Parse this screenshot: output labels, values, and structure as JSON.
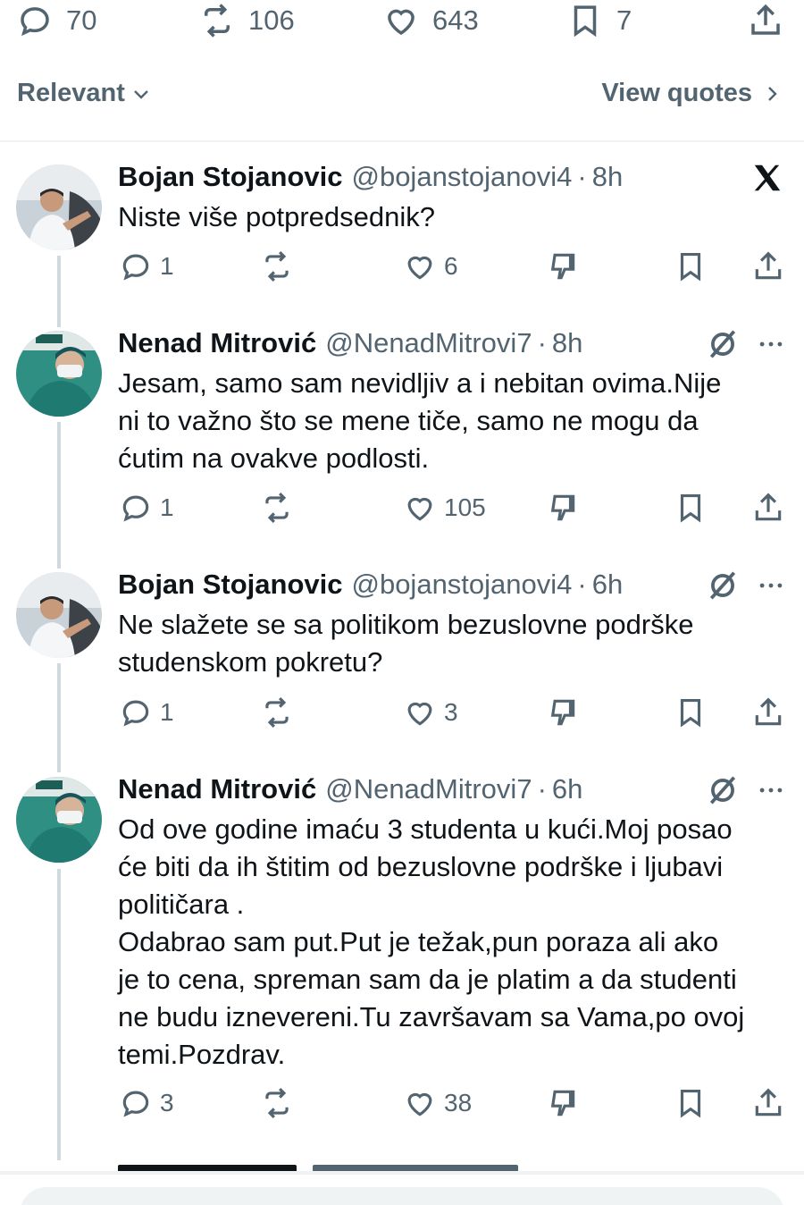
{
  "tweet_stats": {
    "replies": "70",
    "reposts": "106",
    "likes": "643",
    "bookmarks": "7"
  },
  "sort": {
    "label": "Relevant",
    "view_quotes": "View quotes"
  },
  "replies": [
    {
      "name": "Bojan Stojanovic",
      "handle": "@bojanstojanovi4",
      "sep": "·",
      "time": "8h",
      "text": "Niste više potpredsednik?",
      "replies": "1",
      "reposts": "",
      "likes": "6"
    },
    {
      "name": "Nenad Mitrović",
      "handle": "@NenadMitrovi7",
      "sep": "·",
      "time": "8h",
      "text": "Jesam, samo sam nevidljiv a i nebitan ovima.Nije\nni to važno što se mene tiče, samo ne mogu da\nćutim na ovakve podlosti.",
      "replies": "1",
      "reposts": "",
      "likes": "105"
    },
    {
      "name": "Bojan Stojanovic",
      "handle": "@bojanstojanovi4",
      "sep": "·",
      "time": "6h",
      "text": "Ne slažete se sa politikom bezuslovne podrške\nstudenskom pokretu?",
      "replies": "1",
      "reposts": "",
      "likes": "3"
    },
    {
      "name": "Nenad Mitrović",
      "handle": "@NenadMitrovi7",
      "sep": "·",
      "time": "6h",
      "text": "Od ove godine imaću 3 studenta u kući.Moj posao\nće biti da ih štitim od bezuslovne podrške i ljubavi\npolitičara .\nOdabrao sam put.Put je težak,pun poraza ali ako\nje to cena, spreman sam da je platim a da studenti\nne budu izneverenі.Tu završavam sa Vama,po ovoj\ntemi.Pozdrav.",
      "replies": "3",
      "reposts": "",
      "likes": "38"
    }
  ],
  "colors": {
    "text": "#0f1419",
    "muted": "#536471",
    "line": "#cfd9de",
    "divider": "#eff3f4"
  },
  "icons": [
    "reply-icon",
    "repost-icon",
    "like-icon",
    "bookmark-icon",
    "share-icon",
    "chevron-down-icon",
    "chevron-right-icon",
    "x-logo-icon",
    "grok-icon",
    "more-icon",
    "downvote-icon"
  ]
}
